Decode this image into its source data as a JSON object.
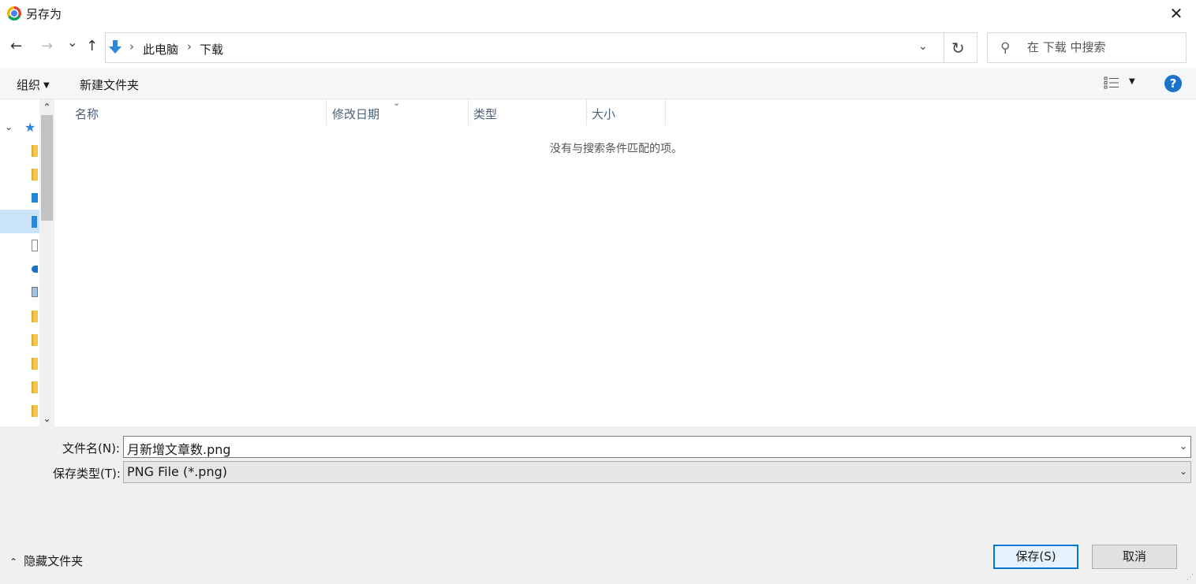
{
  "window": {
    "title": "另存为",
    "close_label": "✕"
  },
  "nav": {
    "back": "←",
    "forward": "→",
    "recent": "⌄",
    "up": "↑",
    "breadcrumb": [
      "此电脑",
      "下载"
    ],
    "separator": "›",
    "dropdown": "⌄",
    "refresh": "↻"
  },
  "search": {
    "placeholder": "在 下载 中搜索"
  },
  "toolbar": {
    "organize": "组织",
    "new_folder": "新建文件夹",
    "help": "?"
  },
  "columns": [
    "名称",
    "修改日期",
    "类型",
    "大小"
  ],
  "empty_message": "没有与搜索条件匹配的项。",
  "form": {
    "filename_label": "文件名(N):",
    "filename_value": "月新增文章数.png",
    "type_label": "保存类型(T):",
    "type_value": "PNG File (*.png)"
  },
  "footer": {
    "hide_folders": "隐藏文件夹",
    "save": "保存(S)",
    "cancel": "取消"
  },
  "colors": {
    "accent": "#0078d7",
    "help": "#1a73c9",
    "selected": "#cce4f7"
  }
}
